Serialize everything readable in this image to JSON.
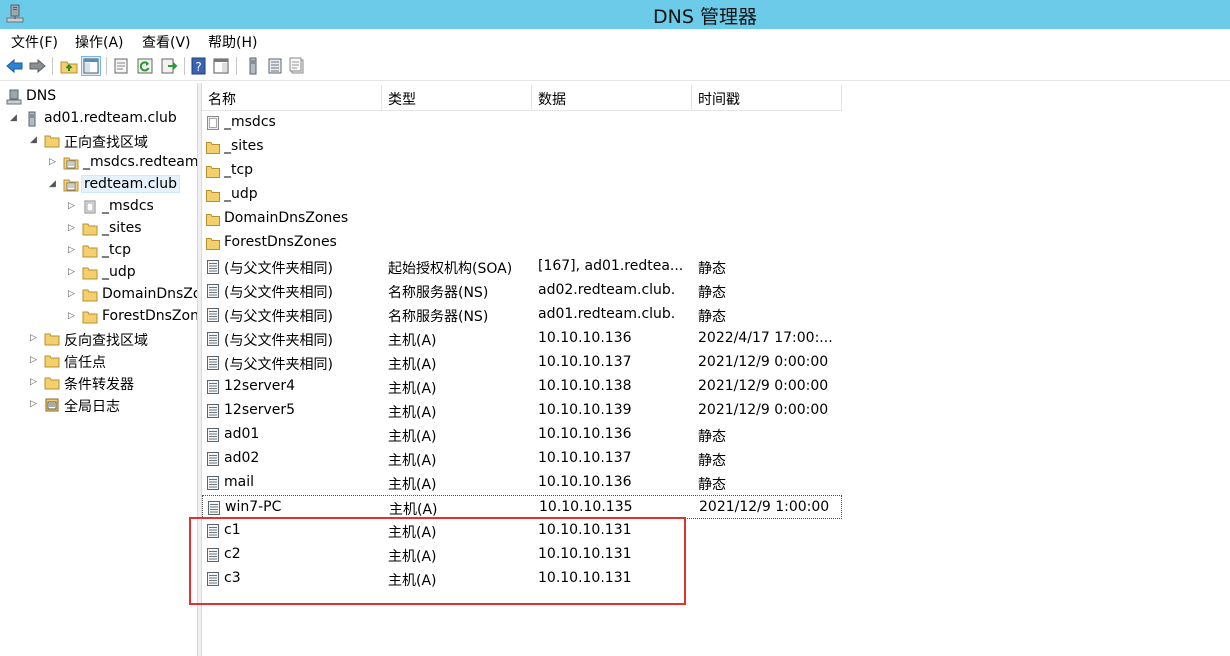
{
  "window": {
    "title": "DNS 管理器"
  },
  "menu": [
    "文件(F)",
    "操作(A)",
    "查看(V)",
    "帮助(H)"
  ],
  "toolbar_icons": [
    "back-arrow-icon",
    "forward-arrow-icon",
    "up-folder-icon",
    "show-hide-tree-icon",
    "properties-icon",
    "refresh-icon",
    "export-list-icon",
    "help-icon",
    "show-scope-icon",
    "server-icon",
    "zone-list-icon",
    "records-icon"
  ],
  "tree": {
    "root": "DNS",
    "server": "ad01.redteam.club",
    "forward_zones": "正向查找区域",
    "msdcs_zone": "_msdcs.redteam.club",
    "redteam_zone": "redteam.club",
    "sub_msdcs": "_msdcs",
    "sub_sites": "_sites",
    "sub_tcp": "_tcp",
    "sub_udp": "_udp",
    "sub_domain": "DomainDnsZones",
    "sub_forest": "ForestDnsZones",
    "reverse_zones": "反向查找区域",
    "trust_points": "信任点",
    "conditional_forwarders": "条件转发器",
    "global_logs": "全局日志"
  },
  "columns": {
    "name": "名称",
    "type": "类型",
    "data": "数据",
    "timestamp": "时间戳"
  },
  "rows": [
    {
      "name": "_msdcs",
      "type": "",
      "data": "",
      "time": "",
      "icon": "delegated-zone-icon"
    },
    {
      "name": "_sites",
      "type": "",
      "data": "",
      "time": "",
      "icon": "folder-icon"
    },
    {
      "name": "_tcp",
      "type": "",
      "data": "",
      "time": "",
      "icon": "folder-icon"
    },
    {
      "name": "_udp",
      "type": "",
      "data": "",
      "time": "",
      "icon": "folder-icon"
    },
    {
      "name": "DomainDnsZones",
      "type": "",
      "data": "",
      "time": "",
      "icon": "folder-icon"
    },
    {
      "name": "ForestDnsZones",
      "type": "",
      "data": "",
      "time": "",
      "icon": "folder-icon"
    },
    {
      "name": "(与父文件夹相同)",
      "type": "起始授权机构(SOA)",
      "data": "[167], ad01.redtea...",
      "time": "静态",
      "icon": "record-icon"
    },
    {
      "name": "(与父文件夹相同)",
      "type": "名称服务器(NS)",
      "data": "ad02.redteam.club.",
      "time": "静态",
      "icon": "record-icon"
    },
    {
      "name": "(与父文件夹相同)",
      "type": "名称服务器(NS)",
      "data": "ad01.redteam.club.",
      "time": "静态",
      "icon": "record-icon"
    },
    {
      "name": "(与父文件夹相同)",
      "type": "主机(A)",
      "data": "10.10.10.136",
      "time": "2022/4/17 17:00:...",
      "icon": "record-icon"
    },
    {
      "name": "(与父文件夹相同)",
      "type": "主机(A)",
      "data": "10.10.10.137",
      "time": "2021/12/9 0:00:00",
      "icon": "record-icon"
    },
    {
      "name": "12server4",
      "type": "主机(A)",
      "data": "10.10.10.138",
      "time": "2021/12/9 0:00:00",
      "icon": "record-icon"
    },
    {
      "name": "12server5",
      "type": "主机(A)",
      "data": "10.10.10.139",
      "time": "2021/12/9 0:00:00",
      "icon": "record-icon"
    },
    {
      "name": "ad01",
      "type": "主机(A)",
      "data": "10.10.10.136",
      "time": "静态",
      "icon": "record-icon"
    },
    {
      "name": "ad02",
      "type": "主机(A)",
      "data": "10.10.10.137",
      "time": "静态",
      "icon": "record-icon"
    },
    {
      "name": "mail",
      "type": "主机(A)",
      "data": "10.10.10.136",
      "time": "静态",
      "icon": "record-icon"
    },
    {
      "name": "win7-PC",
      "type": "主机(A)",
      "data": "10.10.10.135",
      "time": "2021/12/9 1:00:00",
      "icon": "record-icon"
    },
    {
      "name": "c1",
      "type": "主机(A)",
      "data": "10.10.10.131",
      "time": "",
      "icon": "record-icon"
    },
    {
      "name": "c2",
      "type": "主机(A)",
      "data": "10.10.10.131",
      "time": "",
      "icon": "record-icon"
    },
    {
      "name": "c3",
      "type": "主机(A)",
      "data": "10.10.10.131",
      "time": "",
      "icon": "record-icon"
    }
  ],
  "colors": {
    "titlebar": "#6bcbe8",
    "highlight_box": "#e3312f",
    "folder": "#f3cf6e",
    "selection": "#e5f1fb"
  }
}
